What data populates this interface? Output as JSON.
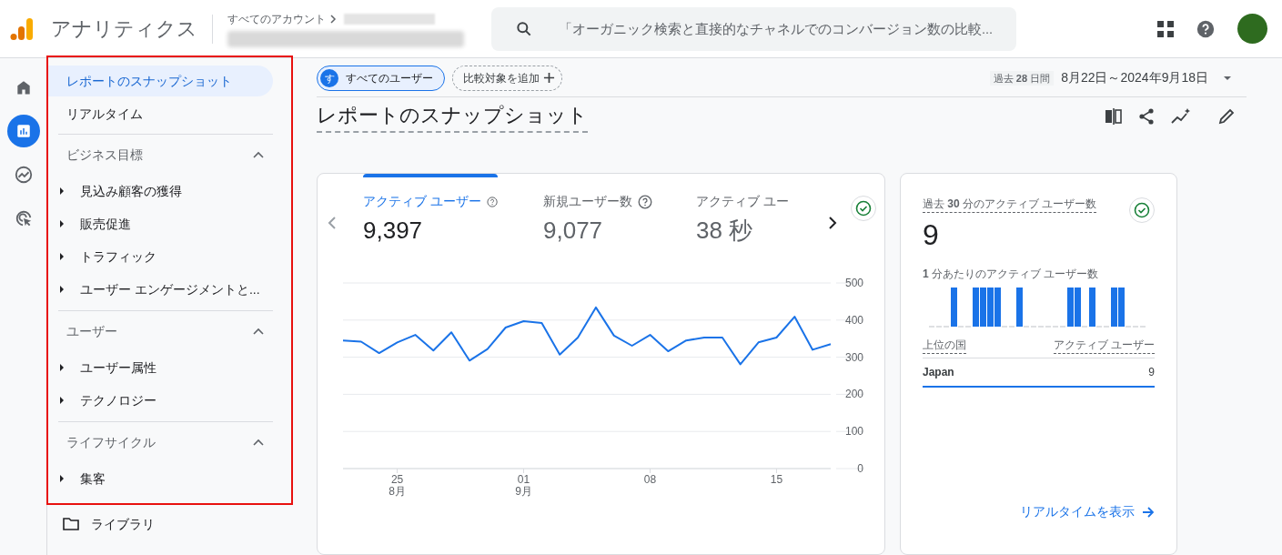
{
  "header": {
    "app_title": "アナリティクス",
    "breadcrumb": "すべてのアカウント",
    "search_placeholder": "「オーガニック検索と直接的なチャネルでのコンバージョン数の比較..."
  },
  "rail": [
    {
      "kind": "home",
      "selected": false
    },
    {
      "kind": "reports",
      "selected": true
    },
    {
      "kind": "explore",
      "selected": false
    },
    {
      "kind": "advertising",
      "selected": false
    }
  ],
  "nav": [
    {
      "kind": "link",
      "label": "レポートのスナップショット",
      "selected": true
    },
    {
      "kind": "link",
      "label": "リアルタイム",
      "selected": false
    },
    {
      "kind": "section",
      "label": "ビジネス目標",
      "expanded": true,
      "children": [
        {
          "label": "見込み顧客の獲得",
          "selected": false
        },
        {
          "label": "販売促進",
          "selected": false
        },
        {
          "label": "トラフィック",
          "selected": false
        },
        {
          "label": "ユーザー エンゲージメントと...",
          "selected": false
        }
      ]
    },
    {
      "kind": "section",
      "label": "ユーザー",
      "expanded": true,
      "children": [
        {
          "label": "ユーザー属性",
          "selected": false
        },
        {
          "label": "テクノロジー",
          "selected": false
        }
      ]
    },
    {
      "kind": "section",
      "label": "ライフサイクル",
      "expanded": true,
      "children": [
        {
          "label": "集客",
          "selected": false
        }
      ]
    }
  ],
  "library": "ライブラリ",
  "filters": {
    "segment_initial": "す",
    "segment_label": "すべてのユーザー",
    "add_comparison": "比較対象を追加"
  },
  "period": "過去 **28** 日間",
  "date_range": "8月22日～2024年9月18日",
  "page_title": "レポートのスナップショット",
  "metrics": [
    {
      "label": "アクティブ ユーザー",
      "value": "9,397",
      "selected": true,
      "help": true
    },
    {
      "label": "新規ユーザー数",
      "value": "9,077",
      "selected": false,
      "help": true
    },
    {
      "label": "アクティブ ユー",
      "value": "38 秒",
      "selected": false,
      "help": false
    }
  ],
  "chart_data": {
    "type": "line",
    "ylim": [
      0,
      500
    ],
    "yticks": [
      0,
      100,
      200,
      300,
      400,
      500
    ],
    "grid": true,
    "categories": [
      null,
      null,
      null,
      "25 8月",
      null,
      null,
      null,
      null,
      null,
      null,
      "01 9月",
      null,
      null,
      null,
      null,
      null,
      null,
      "08",
      null,
      null,
      null,
      null,
      null,
      null,
      "15",
      null,
      null,
      null
    ],
    "series": [
      {
        "color": "#1a73e8",
        "values": [
          345,
          342,
          311,
          340,
          360,
          318,
          367,
          291,
          322,
          380,
          397,
          392,
          307,
          353,
          434,
          358,
          331,
          360,
          316,
          345,
          353,
          353,
          281,
          340,
          353,
          409,
          320,
          335
        ]
      }
    ]
  },
  "realtime": {
    "title": "過去 **30** 分のアクティブ ユーザー数",
    "value": "9",
    "per_minute": "**1** 分あたりのアクティブ ユーザー数",
    "columns": [
      "上位の国",
      "アクティブ ユーザー"
    ],
    "rows": [
      {
        "country": "Japan",
        "users": "9"
      }
    ],
    "link": "リアルタイムを表示"
  }
}
